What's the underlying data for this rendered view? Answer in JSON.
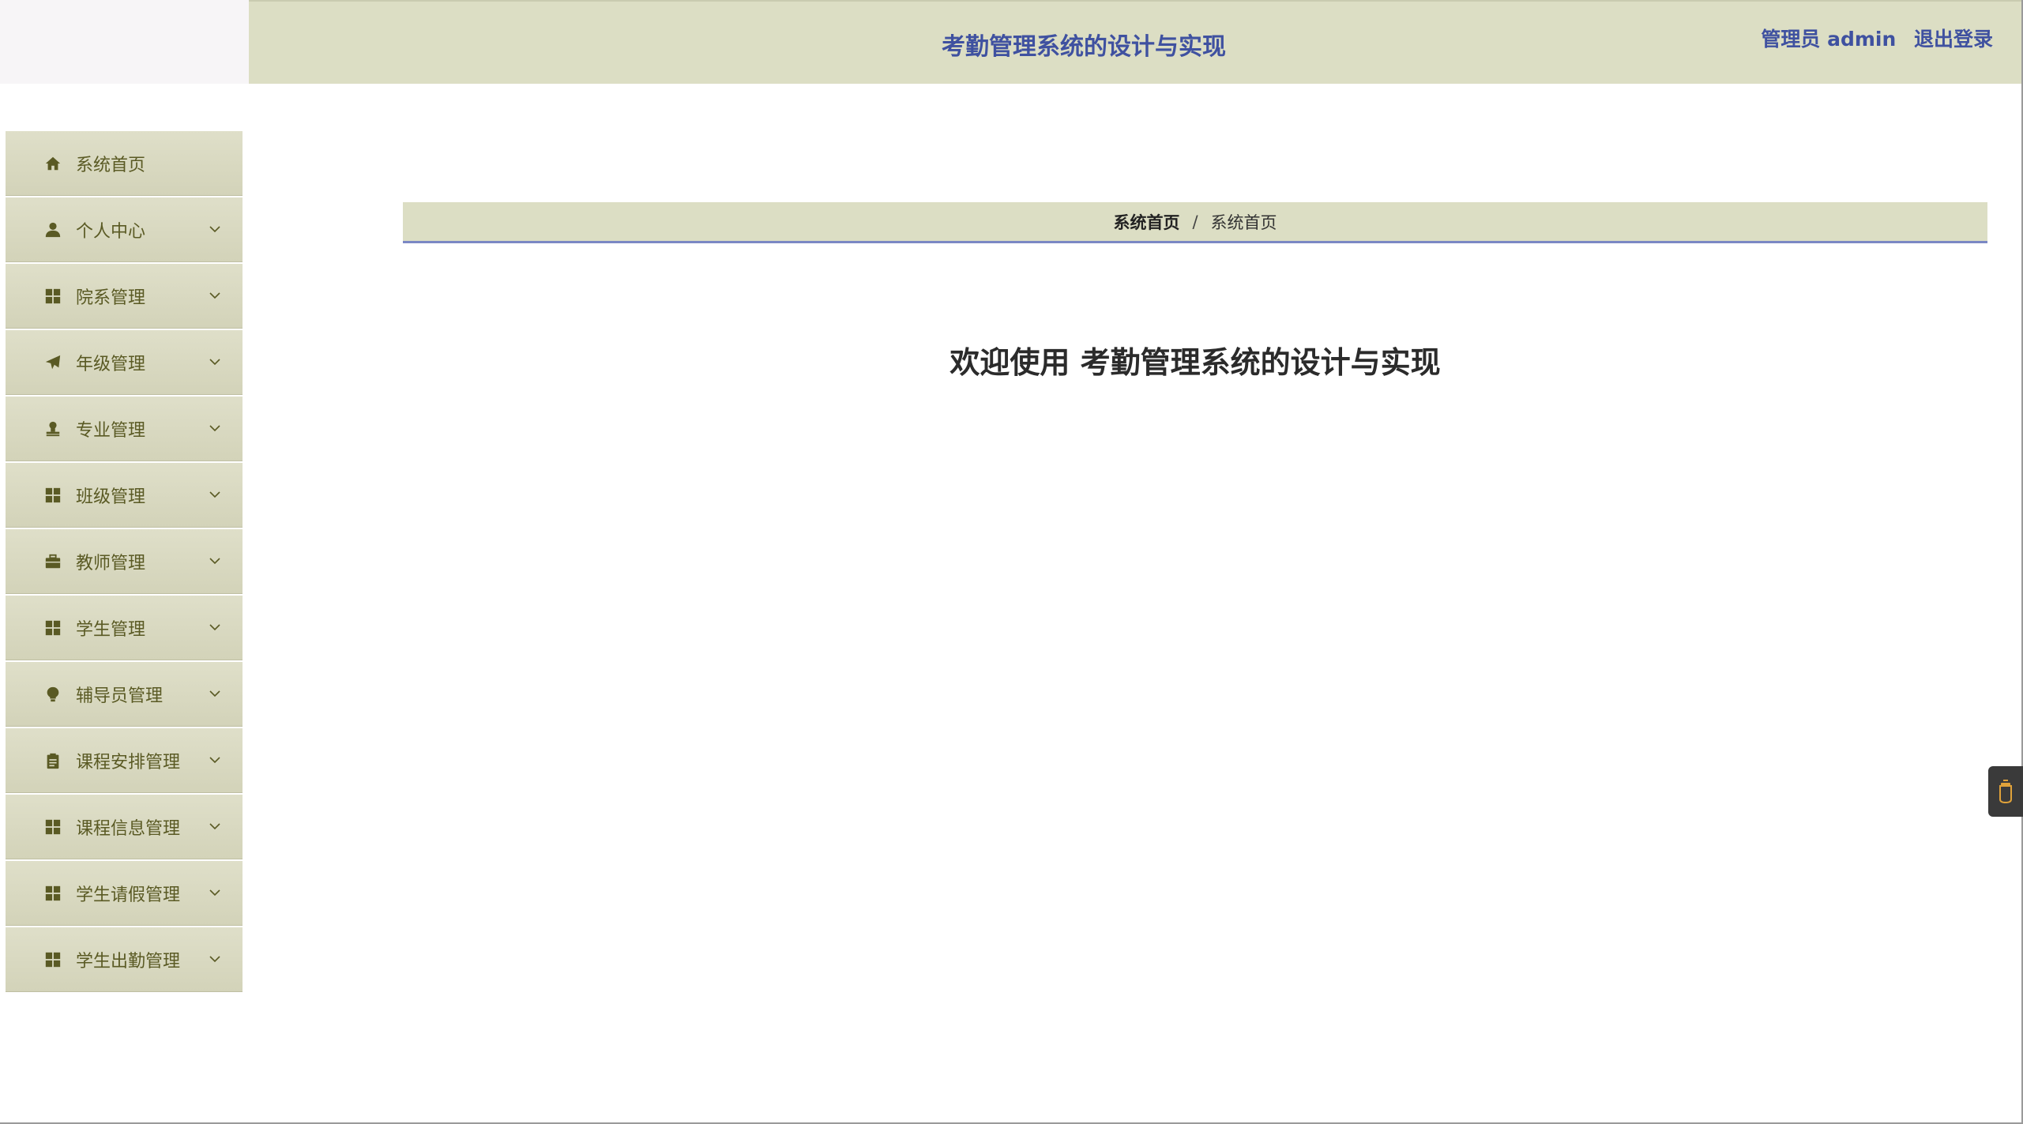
{
  "header": {
    "title": "考勤管理系统的设计与实现",
    "admin_label": "管理员 admin",
    "logout_label": "退出登录",
    "accent_color": "#3f51a0"
  },
  "sidebar": {
    "items": [
      {
        "label": "系统首页",
        "icon": "home-icon",
        "has_submenu": false
      },
      {
        "label": "个人中心",
        "icon": "user-icon",
        "has_submenu": true
      },
      {
        "label": "院系管理",
        "icon": "grid-icon",
        "has_submenu": true
      },
      {
        "label": "年级管理",
        "icon": "paper-plane-icon",
        "has_submenu": true
      },
      {
        "label": "专业管理",
        "icon": "stamp-icon",
        "has_submenu": true
      },
      {
        "label": "班级管理",
        "icon": "grid-icon",
        "has_submenu": true
      },
      {
        "label": "教师管理",
        "icon": "briefcase-icon",
        "has_submenu": true
      },
      {
        "label": "学生管理",
        "icon": "grid-icon",
        "has_submenu": true
      },
      {
        "label": "辅导员管理",
        "icon": "lightbulb-icon",
        "has_submenu": true
      },
      {
        "label": "课程安排管理",
        "icon": "clipboard-icon",
        "has_submenu": true
      },
      {
        "label": "课程信息管理",
        "icon": "grid-icon",
        "has_submenu": true
      },
      {
        "label": "学生请假管理",
        "icon": "grid-icon",
        "has_submenu": true
      },
      {
        "label": "学生出勤管理",
        "icon": "grid-icon",
        "has_submenu": true
      }
    ]
  },
  "breadcrumb": {
    "home": "系统首页",
    "separator": "/",
    "current": "系统首页"
  },
  "main": {
    "welcome": "欢迎使用 考勤管理系统的设计与实现"
  },
  "float_widget": {
    "icon": "cup-icon"
  }
}
